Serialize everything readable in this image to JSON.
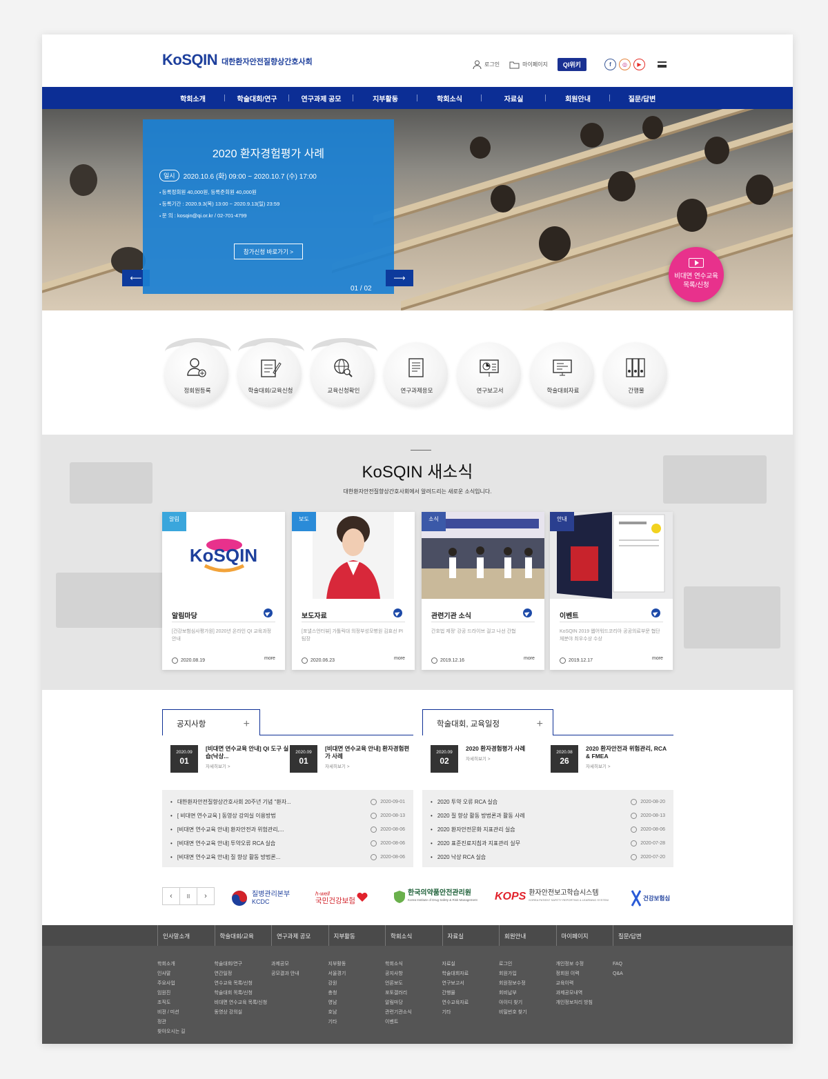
{
  "header": {
    "logo_word": "KoSQIN",
    "org_name": "대한환자안전질향상간호사회",
    "login": "로그인",
    "mypage": "마이페이지",
    "qiwiki": "QI위키"
  },
  "gnb": [
    "학회소개",
    "학술대회/연구",
    "연구과제 공모",
    "지부활동",
    "학회소식",
    "자료실",
    "회원안내",
    "질문/답변"
  ],
  "hero": {
    "title": "2020 환자경험평가 사례",
    "date_tag": "일시",
    "date": "2020.10.6 (화) 09:00 ~ 2020.10.7 (수) 17:00",
    "bullets": [
      "등록정회원 40,000원, 등록준회원 40,000원",
      "등록기간 : 2020.9.3(목) 13:00 ~ 2020.9.13(일) 23:59",
      "문 의 : kosqin@qi.or.kr / 02-701-4799"
    ],
    "apply": "참가신청 바로가기  >",
    "pager": "01 / 02",
    "video_line1": "비대면 연수교육",
    "video_line2": "목록/신청"
  },
  "quick": [
    "정회원등록",
    "학술대회/교육신청",
    "교육신청확인",
    "연구과제응모",
    "연구보고서",
    "학술대회자료",
    "간행물"
  ],
  "news": {
    "title": "KoSQIN 새소식",
    "subtitle": "대한환자안전질향상간호사회에서 알려드리는 새로운 소식입니다.",
    "cards": [
      {
        "cat": "알림",
        "title": "알림마당",
        "desc": "[건강보험심사평가원] 2020년 온라인 QI 교육과정 안내",
        "date": "2020.08.19",
        "more": "more"
      },
      {
        "cat": "보도",
        "title": "보도자료",
        "desc": "[포낼스언터뷰] 가톨릭대 의정부성모병원 김효선 PI 팀장",
        "date": "2020.06.23",
        "more": "more"
      },
      {
        "cat": "소식",
        "title": "관련기관 소식",
        "desc": "간호법 제정' 강공 드라이브 걸고 나선 간협",
        "date": "2019.12.16",
        "more": "more"
      },
      {
        "cat": "안내",
        "title": "이벤트",
        "desc": "KoSQIN 2019 웹어워드코리아 공공의료부문 협단체분야 최우수상 수상",
        "date": "2019.12.17",
        "more": "more"
      }
    ]
  },
  "boards": [
    {
      "tab": "공지사항",
      "plus": "+",
      "highlights": [
        {
          "ym": "2020.09",
          "d": "01",
          "title": "[비대면 연수교육 안내] QI 도구 실습(낙상...",
          "more": "자세히보기 >"
        },
        {
          "ym": "2020.09",
          "d": "01",
          "title": "[비대면 연수교육 안내] 환자경험편가 사례",
          "more": "자세히보기 >"
        }
      ],
      "list": [
        {
          "t": "대한환자안전질향상간호사회 20주년 기념 \"환자...",
          "d": "2020-09-01"
        },
        {
          "t": "[ 비대면 연수교육 ] 동영상 강의실 이용방법",
          "d": "2020-08-13"
        },
        {
          "t": "[비대면 연수교육 안내] 환자안전과 위험관리,...",
          "d": "2020-08-06"
        },
        {
          "t": "[비대면 연수교육 안내] 투약오류 RCA 실습",
          "d": "2020-08-06"
        },
        {
          "t": "[비대면 연수교육 안내] 질 향상 활동 방법론...",
          "d": "2020-08-06"
        }
      ]
    },
    {
      "tab": "학술대회, 교육일정",
      "plus": "+",
      "highlights": [
        {
          "ym": "2020.09",
          "d": "02",
          "title": "2020 환자경험평가 사례",
          "more": "자세히보기 >"
        },
        {
          "ym": "2020.08",
          "d": "26",
          "title": "2020 환자안전과 위험관리, RCA & FMEA",
          "more": "자세히보기 >"
        }
      ],
      "list": [
        {
          "t": "2020 투약 오류 RCA 실습",
          "d": "2020-08-20"
        },
        {
          "t": "2020 질 향상 활동 방법론과 활동 사례",
          "d": "2020-08-13"
        },
        {
          "t": "2020 환자안전문화 지표관리 실습",
          "d": "2020-08-06"
        },
        {
          "t": "2020 표준진료지침과 지표관리 실무",
          "d": "2020-07-28"
        },
        {
          "t": "2020 낙상 RCA 실습",
          "d": "2020-07-20"
        }
      ]
    }
  ],
  "banners": {
    "prev": "‹",
    "pause": "II",
    "next": "›",
    "kdca": "질병관리본부",
    "kdca_en": "KCDC",
    "hwell": "h-well",
    "nhis": "국민건강보험",
    "mfds": "한국의약품안전관리원",
    "mfds_en": "Korea Institute of Drug Safety & Risk Management",
    "kops": "KOPS",
    "kops_name": "환자안전보고학습시스템",
    "kops_en": "KOREA PATIENT SAFETY REPORTING & LEARNING SYSTEM",
    "hira": "건강보험심"
  },
  "footer": [
    {
      "h": "인사말소개",
      "items": [
        "학회소개",
        "인사말",
        "주요사업",
        "임원진",
        "조직도",
        "비젼 / 미션",
        "정관",
        "찾아오시는 길"
      ]
    },
    {
      "h": "학술대회/교육",
      "items": [
        "학술대회/연구",
        "연간일정",
        "연수교육 목록/신청",
        "학술대회 목록/신청",
        "비대면 연수교육 목록/신청",
        "동영상 강의실"
      ]
    },
    {
      "h": "연구과제 공모",
      "items": [
        "과제공모",
        "공모결과 안내"
      ]
    },
    {
      "h": "지부활동",
      "items": [
        "지부활동",
        "서울경기",
        "강원",
        "충청",
        "영남",
        "호남",
        "기타"
      ]
    },
    {
      "h": "학회소식",
      "items": [
        "학회소식",
        "공지사항",
        "언론보도",
        "포토갤러리",
        "알림마당",
        "관련기관소식",
        "이벤트"
      ]
    },
    {
      "h": "자료실",
      "items": [
        "자료실",
        "학술대회자료",
        "연구보고서",
        "간행물",
        "연수교육자료",
        "기타"
      ]
    },
    {
      "h": "회원안내",
      "items": [
        "로그인",
        "회원가입",
        "회원정보수정",
        "회비납부",
        "아이디 찾기",
        "비밀번호 찾기"
      ]
    },
    {
      "h": "마이페이지",
      "items": [
        "개인정보 수정",
        "정회원 이력",
        "교육이력",
        "과제공모내역",
        "개인정보처리 방침"
      ]
    },
    {
      "h": "질문/답변",
      "items": [
        "FAQ",
        "Q&A"
      ]
    }
  ],
  "colors": {
    "brand": "#0c2e95",
    "accent": "#e8318c",
    "panel": "#1b80d2",
    "tag": "#3aa6dc"
  }
}
